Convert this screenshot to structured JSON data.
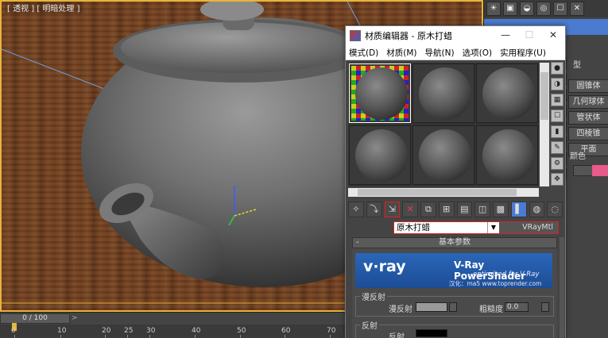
{
  "viewport": {
    "label": "[ 透视 ] [ 明暗处理 ]"
  },
  "timeline": {
    "slider_text": "0 / 100",
    "ticks": [
      "0",
      "10",
      "20",
      "25",
      "30",
      "40",
      "50",
      "60",
      "70"
    ]
  },
  "command_panel": {
    "object_type_heading": "型",
    "object_buttons": [
      "圆锥体",
      "几何球体",
      "管状体",
      "四棱锥",
      "平面"
    ],
    "color_label": "颜色",
    "accent_color": "#e85a8a"
  },
  "material_editor": {
    "title": "材质编辑器 - 原木打蜡",
    "menu": [
      "模式(D)",
      "材质(M)",
      "导航(N)",
      "选项(O)",
      "实用程序(U)"
    ],
    "window_buttons": [
      "—",
      "☐",
      "✕"
    ],
    "material_name": "原木打蜡",
    "material_type": "VRayMtl",
    "rollout_title": "基本参数",
    "vray_banner": {
      "logo": "v·ray",
      "title": "V-Ray PowerShader",
      "subtitle": "optimized for V-Ray",
      "credit": "汉化：ma5 www.toprender.com"
    },
    "diffuse_group": "漫反射",
    "diffuse_label": "漫反射",
    "roughness_label": "粗糙度",
    "roughness_value": "0.0",
    "reflection_group": "反射",
    "reflection_label": "反射"
  }
}
